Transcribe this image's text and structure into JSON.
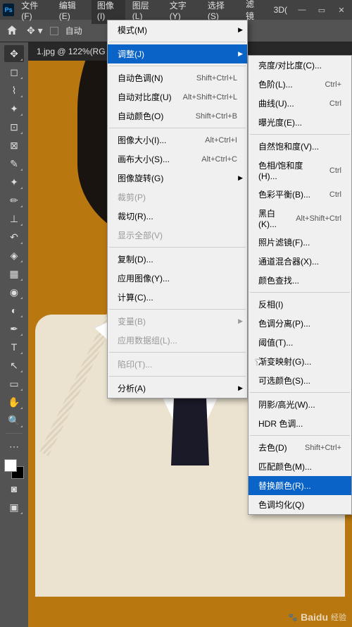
{
  "menubar": [
    "文件(F)",
    "编辑(E)",
    "图像(I)",
    "图层(L)",
    "文字(Y)",
    "选择(S)",
    "滤镜"
  ],
  "extraMenu": "3D(",
  "options": {
    "auto": "自动"
  },
  "tab": "1.jpg @ 122%(RG",
  "imageMenu": {
    "mode": "模式(M)",
    "adjust": "调整(J)",
    "autoTone": {
      "label": "自动色调(N)",
      "key": "Shift+Ctrl+L"
    },
    "autoContrast": {
      "label": "自动对比度(U)",
      "key": "Alt+Shift+Ctrl+L"
    },
    "autoColor": {
      "label": "自动颜色(O)",
      "key": "Shift+Ctrl+B"
    },
    "imageSize": {
      "label": "图像大小(I)...",
      "key": "Alt+Ctrl+I"
    },
    "canvasSize": {
      "label": "画布大小(S)...",
      "key": "Alt+Ctrl+C"
    },
    "rotate": "图像旋转(G)",
    "crop": "裁剪(P)",
    "trim": "裁切(R)...",
    "revealAll": "显示全部(V)",
    "duplicate": "复制(D)...",
    "applyImage": "应用图像(Y)...",
    "calculations": "计算(C)...",
    "variables": "变量(B)",
    "applyDataset": "应用数据组(L)...",
    "trap": "陷印(T)...",
    "analysis": "分析(A)"
  },
  "adjustMenu": {
    "brightness": "亮度/对比度(C)...",
    "levels": {
      "label": "色阶(L)...",
      "key": "Ctrl+"
    },
    "curves": {
      "label": "曲线(U)...",
      "key": "Ctrl"
    },
    "exposure": "曝光度(E)...",
    "vibrance": "自然饱和度(V)...",
    "hue": {
      "label": "色相/饱和度(H)...",
      "key": "Ctrl"
    },
    "colorBalance": {
      "label": "色彩平衡(B)...",
      "key": "Ctrl"
    },
    "bw": {
      "label": "黑白(K)...",
      "key": "Alt+Shift+Ctrl"
    },
    "photoFilter": "照片滤镜(F)...",
    "channelMixer": "通道混合器(X)...",
    "colorLookup": "颜色查找...",
    "invert": "反相(I)",
    "posterize": "色调分离(P)...",
    "threshold": "阈值(T)...",
    "gradientMap": "渐变映射(G)...",
    "selectiveColor": "可选颜色(S)...",
    "shadowHighlight": "阴影/高光(W)...",
    "hdr": "HDR 色调...",
    "desaturate": {
      "label": "去色(D)",
      "key": "Shift+Ctrl+"
    },
    "matchColor": "匹配颜色(M)...",
    "replaceColor": "替换颜色(R)...",
    "equalize": "色调均化(Q)"
  },
  "watermark": {
    "brand": "Baidu",
    "sub": "经验"
  }
}
